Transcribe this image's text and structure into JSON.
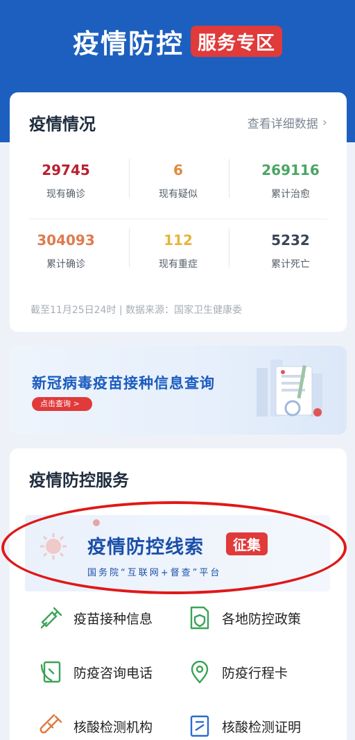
{
  "header": {
    "title": "疫情防控",
    "badge": "服务专区"
  },
  "stats": {
    "title": "疫情情况",
    "detail_link": "查看详细数据",
    "items": [
      {
        "value": "29745",
        "label": "现有确诊",
        "color": "#b8202f"
      },
      {
        "value": "6",
        "label": "现有疑似",
        "color": "#e08a3a"
      },
      {
        "value": "269116",
        "label": "累计治愈",
        "color": "#4aa564"
      },
      {
        "value": "304093",
        "label": "累计确诊",
        "color": "#e07a4e"
      },
      {
        "value": "112",
        "label": "现有重症",
        "color": "#e6b53c"
      },
      {
        "value": "5232",
        "label": "累计死亡",
        "color": "#3a4656"
      }
    ],
    "source": "截至11月25日24时 | 数据来源：国家卫生健康委"
  },
  "vaccine_banner": {
    "title": "新冠病毒疫苗接种信息查询",
    "button": "点击查询 >"
  },
  "services": {
    "title": "疫情防控服务",
    "clue_banner": {
      "title": "疫情防控线索",
      "badge": "征集",
      "subtitle": "国务院“互联网+督查”平台"
    },
    "items": [
      {
        "label": "疫苗接种信息",
        "icon": "syringe-icon"
      },
      {
        "label": "各地防控政策",
        "icon": "policy-shield-icon"
      },
      {
        "label": "防疫咨询电话",
        "icon": "phone-icon"
      },
      {
        "label": "防疫行程卡",
        "icon": "location-pin-icon"
      },
      {
        "label": "核酸检测机构",
        "icon": "test-tube-icon"
      },
      {
        "label": "核酸检测证明",
        "icon": "certificate-icon"
      }
    ]
  }
}
